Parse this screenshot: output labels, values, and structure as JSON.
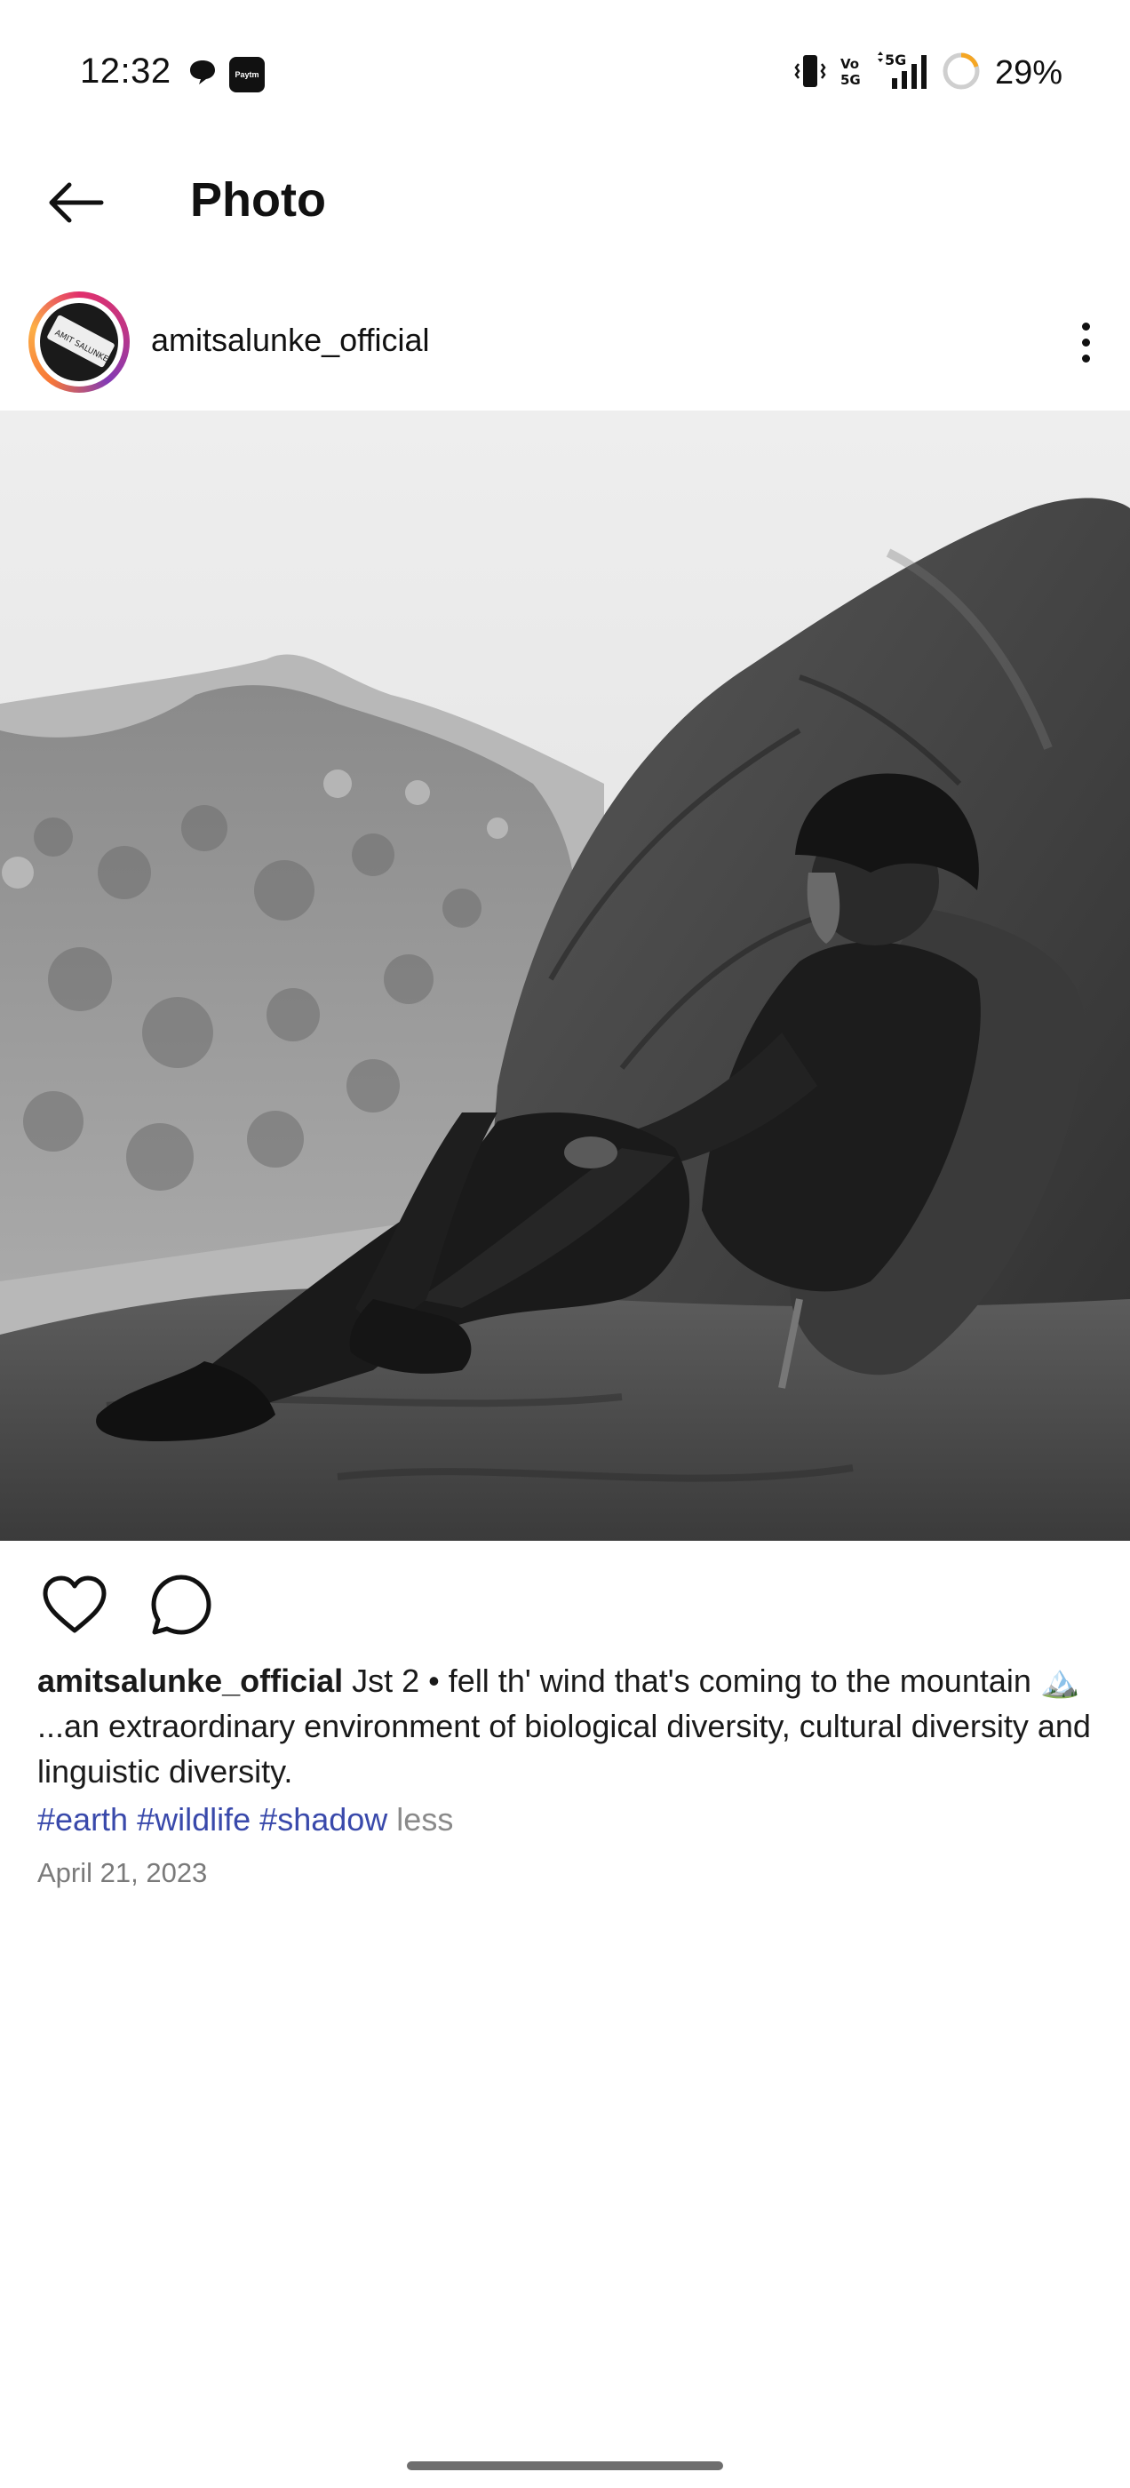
{
  "status_bar": {
    "time": "12:32",
    "battery": "29%",
    "notification_icons": [
      "chat-bubble-icon",
      "paytm-icon"
    ],
    "paytm_label": "Paytm",
    "right_icons": [
      "vibrate-icon",
      "volte-icon",
      "5g-signal-icon",
      "battery-ring-icon"
    ],
    "volte_label_top": "Vo",
    "volte_label_bottom": "5G",
    "network_label": "5G"
  },
  "app_bar": {
    "title": "Photo",
    "back_icon": "arrow-left-icon"
  },
  "post": {
    "username": "amitsalunke_official",
    "avatar_card_text": "AMIT SALUNKE",
    "more_icon": "more-vertical-icon",
    "photo_icon": "mountain-photo",
    "actions": [
      "heart-icon",
      "comment-icon"
    ],
    "caption": {
      "username": "amitsalunke_official",
      "text": "Jst 2 • fell th'  wind that's coming to the mountain 🏔️ ...an extraordinary environment of biological diversity, cultural diversity and linguistic diversity."
    },
    "hashtags": [
      "#earth",
      "#wildlife",
      "#shadow"
    ],
    "less_label": "less",
    "date": "April 21, 2023"
  },
  "colors": {
    "hashtag": "#3949ab",
    "muted": "#7a7a7a",
    "battery_ring": "#f5a623"
  }
}
